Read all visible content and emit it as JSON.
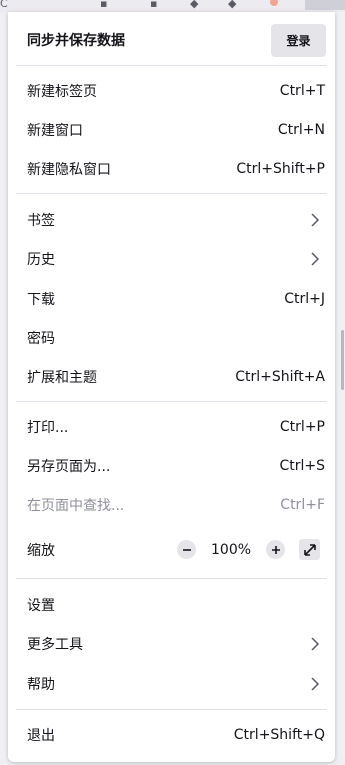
{
  "header": {
    "title": "同步并保存数据",
    "login_label": "登录"
  },
  "menu": {
    "new_tab": {
      "label": "新建标签页",
      "shortcut": "Ctrl+T"
    },
    "new_window": {
      "label": "新建窗口",
      "shortcut": "Ctrl+N"
    },
    "new_private_window": {
      "label": "新建隐私窗口",
      "shortcut": "Ctrl+Shift+P"
    },
    "bookmarks": {
      "label": "书签"
    },
    "history": {
      "label": "历史"
    },
    "downloads": {
      "label": "下载",
      "shortcut": "Ctrl+J"
    },
    "passwords": {
      "label": "密码"
    },
    "addons_themes": {
      "label": "扩展和主题",
      "shortcut": "Ctrl+Shift+A"
    },
    "print": {
      "label": "打印...",
      "shortcut": "Ctrl+P"
    },
    "save_page_as": {
      "label": "另存页面为...",
      "shortcut": "Ctrl+S"
    },
    "find_in_page": {
      "label": "在页面中查找...",
      "shortcut": "Ctrl+F",
      "disabled": true
    },
    "zoom": {
      "label": "缩放",
      "value": "100%"
    },
    "settings": {
      "label": "设置"
    },
    "more_tools": {
      "label": "更多工具"
    },
    "help": {
      "label": "帮助"
    },
    "quit": {
      "label": "退出",
      "shortcut": "Ctrl+Shift+Q"
    }
  },
  "colors": {
    "menu_bg": "#ffffff",
    "page_bg": "#f0f0f4",
    "text": "#15141a",
    "disabled_text": "#8f8f9d",
    "button_bg": "#e5e5e9"
  },
  "icons": [
    "chevron-right-icon",
    "zoom-out-icon",
    "zoom-in-icon",
    "fullscreen-icon"
  ]
}
